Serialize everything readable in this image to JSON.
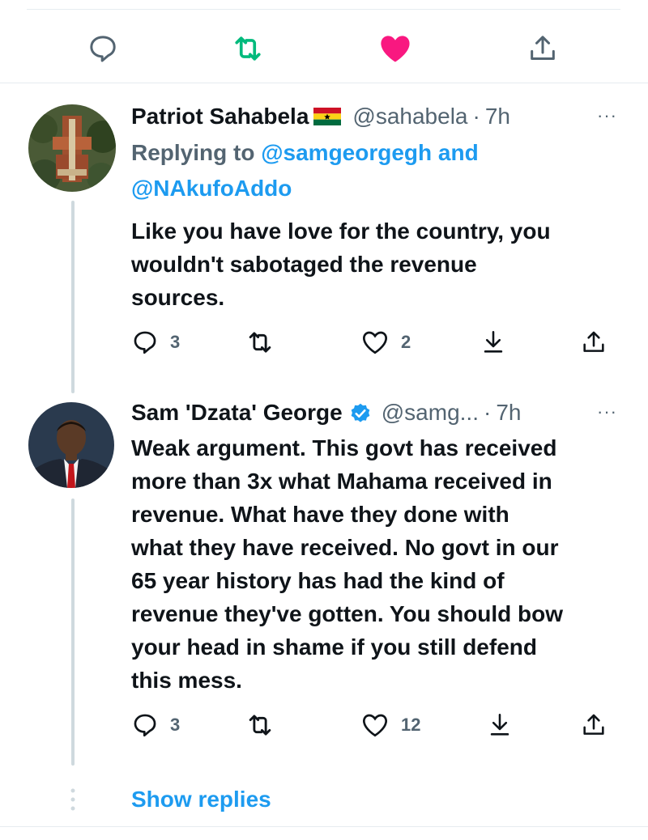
{
  "colors": {
    "accent": "#1d9bf0",
    "retweet": "#00ba7c",
    "like": "#f91880",
    "muted": "#536471",
    "text": "#0f1419"
  },
  "action_bar": {
    "reply_icon": "speech-bubble-icon",
    "retweet_icon": "retweet-icon",
    "like_icon": "heart-filled-icon",
    "share_icon": "share-icon"
  },
  "tweets": [
    {
      "name": "Patriot Sahabela",
      "flag": "ghana-flag-icon",
      "handle": "@sahabela",
      "dot": "·",
      "time": "7h",
      "more": "···",
      "replying_prefix": "Replying to",
      "replying_to_1": "@samgeorgegh",
      "replying_and": "and",
      "replying_to_2": "@NAkufoAddo",
      "text_lines": [
        "Like you have love for the country, you",
        "wouldn't sabotaged the revenue",
        "sources."
      ],
      "replies": "3",
      "retweets": "",
      "likes": "2"
    },
    {
      "name": "Sam 'Dzata' George",
      "verified": true,
      "handle": "@samg...",
      "dot": "·",
      "time": "7h",
      "more": "···",
      "text_lines": [
        "Weak argument. This govt has received",
        "more than 3x what Mahama received in",
        "revenue. What have they done with",
        "what they have received. No govt in our",
        "65 year history has had the kind of",
        "revenue they've gotten. You should bow",
        "your head in shame if you still defend",
        "this mess."
      ],
      "replies": "3",
      "retweets": "",
      "likes": "12"
    }
  ],
  "show_replies": "Show replies"
}
